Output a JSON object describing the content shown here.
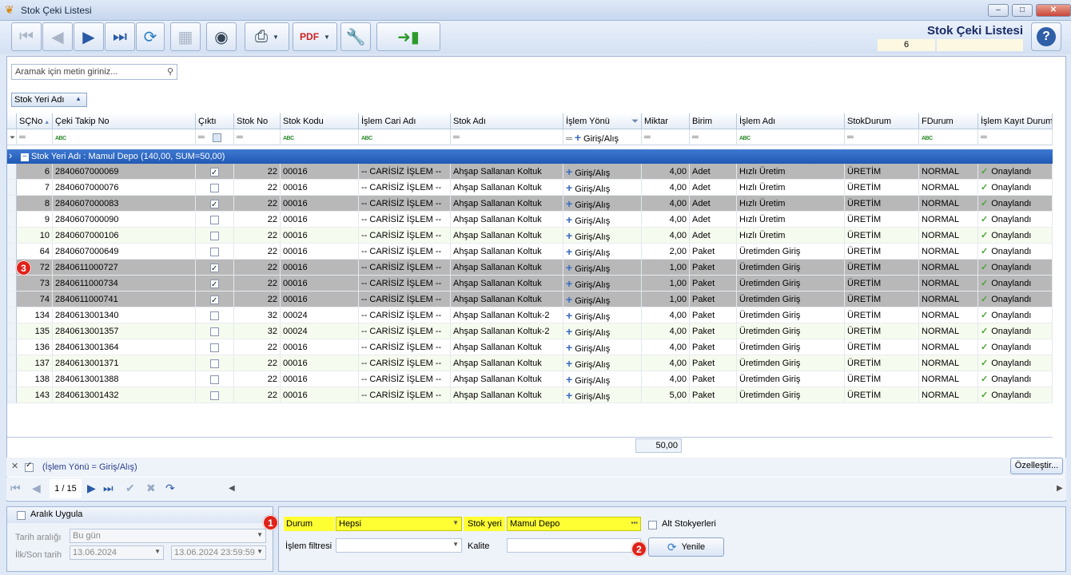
{
  "window": {
    "title": "Stok Çeki Listesi",
    "minimize": "–",
    "maximize": "□",
    "close": "✕"
  },
  "toolbar": {
    "header_title": "Stok Çeki Listesi",
    "record_count": "6",
    "help_label": "?"
  },
  "search": {
    "placeholder": "Aramak için metin giriniz..."
  },
  "group_chip": {
    "label": "Stok Yeri Adı"
  },
  "columns": [
    "SÇNo",
    "Çeki Takip No",
    "Çıktı",
    "Stok No",
    "Stok Kodu",
    "İşlem Cari Adı",
    "Stok Adı",
    "İşlem Yönü",
    "Miktar",
    "Birim",
    "İşlem Adı",
    "StokDurum",
    "FDurum",
    "İşlem Kayıt Durumu"
  ],
  "filter_row": {
    "islem_yonu": "Giriş/Alış"
  },
  "group_row": {
    "text": "Stok Yeri Adı : Mamul Depo (140,00, SUM=50,00)"
  },
  "rows": [
    {
      "no": "6",
      "takip": "2840607000069",
      "cikti": true,
      "stokno": "22",
      "kodu": "00016",
      "cari": "-- CARİSİZ İŞLEM --",
      "stokadi": "Ahşap Sallanan Koltuk",
      "yon": "Giriş/Alış",
      "miktar": "4,00",
      "birim": "Adet",
      "islem": "Hızlı Üretim",
      "stokdurum": "ÜRETİM",
      "fdurum": "NORMAL",
      "kayit": "Onaylandı",
      "style": "sel"
    },
    {
      "no": "7",
      "takip": "2840607000076",
      "cikti": false,
      "stokno": "22",
      "kodu": "00016",
      "cari": "-- CARİSİZ İŞLEM --",
      "stokadi": "Ahşap Sallanan Koltuk",
      "yon": "Giriş/Alış",
      "miktar": "4,00",
      "birim": "Adet",
      "islem": "Hızlı Üretim",
      "stokdurum": "ÜRETİM",
      "fdurum": "NORMAL",
      "kayit": "Onaylandı",
      "style": "plain"
    },
    {
      "no": "8",
      "takip": "2840607000083",
      "cikti": true,
      "stokno": "22",
      "kodu": "00016",
      "cari": "-- CARİSİZ İŞLEM --",
      "stokadi": "Ahşap Sallanan Koltuk",
      "yon": "Giriş/Alış",
      "miktar": "4,00",
      "birim": "Adet",
      "islem": "Hızlı Üretim",
      "stokdurum": "ÜRETİM",
      "fdurum": "NORMAL",
      "kayit": "Onaylandı",
      "style": "sel"
    },
    {
      "no": "9",
      "takip": "2840607000090",
      "cikti": false,
      "stokno": "22",
      "kodu": "00016",
      "cari": "-- CARİSİZ İŞLEM --",
      "stokadi": "Ahşap Sallanan Koltuk",
      "yon": "Giriş/Alış",
      "miktar": "4,00",
      "birim": "Adet",
      "islem": "Hızlı Üretim",
      "stokdurum": "ÜRETİM",
      "fdurum": "NORMAL",
      "kayit": "Onaylandı",
      "style": "plain"
    },
    {
      "no": "10",
      "takip": "2840607000106",
      "cikti": false,
      "stokno": "22",
      "kodu": "00016",
      "cari": "-- CARİSİZ İŞLEM --",
      "stokadi": "Ahşap Sallanan Koltuk",
      "yon": "Giriş/Alış",
      "miktar": "4,00",
      "birim": "Adet",
      "islem": "Hızlı Üretim",
      "stokdurum": "ÜRETİM",
      "fdurum": "NORMAL",
      "kayit": "Onaylandı",
      "style": "alt"
    },
    {
      "no": "64",
      "takip": "2840607000649",
      "cikti": false,
      "stokno": "22",
      "kodu": "00016",
      "cari": "-- CARİSİZ İŞLEM --",
      "stokadi": "Ahşap Sallanan Koltuk",
      "yon": "Giriş/Alış",
      "miktar": "2,00",
      "birim": "Paket",
      "islem": "Üretimden Giriş",
      "stokdurum": "ÜRETİM",
      "fdurum": "NORMAL",
      "kayit": "Onaylandı",
      "style": "plain"
    },
    {
      "no": "72",
      "takip": "2840611000727",
      "cikti": true,
      "stokno": "22",
      "kodu": "00016",
      "cari": "-- CARİSİZ İŞLEM --",
      "stokadi": "Ahşap Sallanan Koltuk",
      "yon": "Giriş/Alış",
      "miktar": "1,00",
      "birim": "Paket",
      "islem": "Üretimden Giriş",
      "stokdurum": "ÜRETİM",
      "fdurum": "NORMAL",
      "kayit": "Onaylandı",
      "style": "sel"
    },
    {
      "no": "73",
      "takip": "2840611000734",
      "cikti": true,
      "stokno": "22",
      "kodu": "00016",
      "cari": "-- CARİSİZ İŞLEM --",
      "stokadi": "Ahşap Sallanan Koltuk",
      "yon": "Giriş/Alış",
      "miktar": "1,00",
      "birim": "Paket",
      "islem": "Üretimden Giriş",
      "stokdurum": "ÜRETİM",
      "fdurum": "NORMAL",
      "kayit": "Onaylandı",
      "style": "sel"
    },
    {
      "no": "74",
      "takip": "2840611000741",
      "cikti": true,
      "stokno": "22",
      "kodu": "00016",
      "cari": "-- CARİSİZ İŞLEM --",
      "stokadi": "Ahşap Sallanan Koltuk",
      "yon": "Giriş/Alış",
      "miktar": "1,00",
      "birim": "Paket",
      "islem": "Üretimden Giriş",
      "stokdurum": "ÜRETİM",
      "fdurum": "NORMAL",
      "kayit": "Onaylandı",
      "style": "sel"
    },
    {
      "no": "134",
      "takip": "2840613001340",
      "cikti": false,
      "stokno": "32",
      "kodu": "00024",
      "cari": "-- CARİSİZ İŞLEM --",
      "stokadi": "Ahşap Sallanan Koltuk-2",
      "yon": "Giriş/Alış",
      "miktar": "4,00",
      "birim": "Paket",
      "islem": "Üretimden Giriş",
      "stokdurum": "ÜRETİM",
      "fdurum": "NORMAL",
      "kayit": "Onaylandı",
      "style": "plain"
    },
    {
      "no": "135",
      "takip": "2840613001357",
      "cikti": false,
      "stokno": "32",
      "kodu": "00024",
      "cari": "-- CARİSİZ İŞLEM --",
      "stokadi": "Ahşap Sallanan Koltuk-2",
      "yon": "Giriş/Alış",
      "miktar": "4,00",
      "birim": "Paket",
      "islem": "Üretimden Giriş",
      "stokdurum": "ÜRETİM",
      "fdurum": "NORMAL",
      "kayit": "Onaylandı",
      "style": "alt"
    },
    {
      "no": "136",
      "takip": "2840613001364",
      "cikti": false,
      "stokno": "22",
      "kodu": "00016",
      "cari": "-- CARİSİZ İŞLEM --",
      "stokadi": "Ahşap Sallanan Koltuk",
      "yon": "Giriş/Alış",
      "miktar": "4,00",
      "birim": "Paket",
      "islem": "Üretimden Giriş",
      "stokdurum": "ÜRETİM",
      "fdurum": "NORMAL",
      "kayit": "Onaylandı",
      "style": "plain"
    },
    {
      "no": "137",
      "takip": "2840613001371",
      "cikti": false,
      "stokno": "22",
      "kodu": "00016",
      "cari": "-- CARİSİZ İŞLEM --",
      "stokadi": "Ahşap Sallanan Koltuk",
      "yon": "Giriş/Alış",
      "miktar": "4,00",
      "birim": "Paket",
      "islem": "Üretimden Giriş",
      "stokdurum": "ÜRETİM",
      "fdurum": "NORMAL",
      "kayit": "Onaylandı",
      "style": "alt"
    },
    {
      "no": "138",
      "takip": "2840613001388",
      "cikti": false,
      "stokno": "22",
      "kodu": "00016",
      "cari": "-- CARİSİZ İŞLEM --",
      "stokadi": "Ahşap Sallanan Koltuk",
      "yon": "Giriş/Alış",
      "miktar": "4,00",
      "birim": "Paket",
      "islem": "Üretimden Giriş",
      "stokdurum": "ÜRETİM",
      "fdurum": "NORMAL",
      "kayit": "Onaylandı",
      "style": "plain"
    },
    {
      "no": "143",
      "takip": "2840613001432",
      "cikti": false,
      "stokno": "22",
      "kodu": "00016",
      "cari": "-- CARİSİZ İŞLEM --",
      "stokadi": "Ahşap Sallanan Koltuk",
      "yon": "Giriş/Alış",
      "miktar": "5,00",
      "birim": "Paket",
      "islem": "Üretimden Giriş",
      "stokdurum": "ÜRETİM",
      "fdurum": "NORMAL",
      "kayit": "Onaylandı",
      "style": "alt"
    }
  ],
  "footer": {
    "sum_miktar": "50,00"
  },
  "filter_bar": {
    "text": "(İşlem Yönü = Giriş/Alış)",
    "customize": "Özelleştir..."
  },
  "navigator": {
    "page": "1 / 15"
  },
  "date_panel": {
    "title": "Aralık Uygula",
    "range_label": "Tarih aralığı",
    "range_value": "Bu gün",
    "first_last_label": "İlk/Son tarih",
    "first_date": "13.06.2024",
    "last_date": "13.06.2024 23:59:59"
  },
  "filter_panel": {
    "durum_label": "Durum",
    "durum_value": "Hepsi",
    "stokyeri_label": "Stok yeri",
    "stokyeri_value": "Mamul Depo",
    "alt_label": "Alt Stokyerleri",
    "islem_filtresi_label": "İşlem filtresi",
    "kalite_label": "Kalite",
    "yenile_label": "Yenile"
  },
  "badges": {
    "b1": "1",
    "b2": "2",
    "b3": "3"
  },
  "colors": {
    "highlight": "#ffff33",
    "badge": "#e0231a",
    "group_row": "#2059b5",
    "selected_row": "#b8b8b8",
    "check": "#4aa33a"
  }
}
